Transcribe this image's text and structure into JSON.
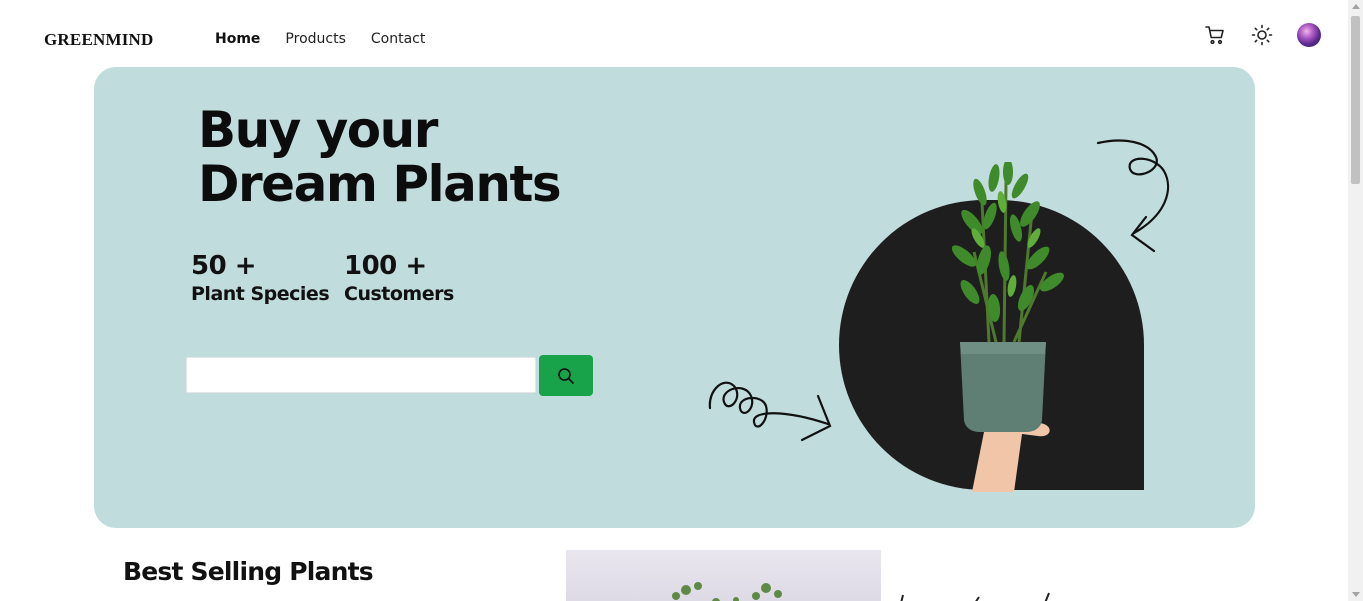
{
  "header": {
    "brand": "GREENMIND",
    "nav": [
      {
        "label": "Home",
        "active": true
      },
      {
        "label": "Products",
        "active": false
      },
      {
        "label": "Contact",
        "active": false
      }
    ],
    "icons": [
      "cart-icon",
      "sun-icon",
      "avatar"
    ]
  },
  "hero": {
    "title_line1": "Buy your",
    "title_line2": "Dream Plants",
    "stats": [
      {
        "value": "50 +",
        "label": "Plant Species"
      },
      {
        "value": "100 +",
        "label": "Customers"
      }
    ],
    "search": {
      "placeholder": "",
      "value": ""
    },
    "background_color": "#c1dcdd",
    "button_color": "#18a24a"
  },
  "best_selling": {
    "title": "Best Selling Plants"
  }
}
